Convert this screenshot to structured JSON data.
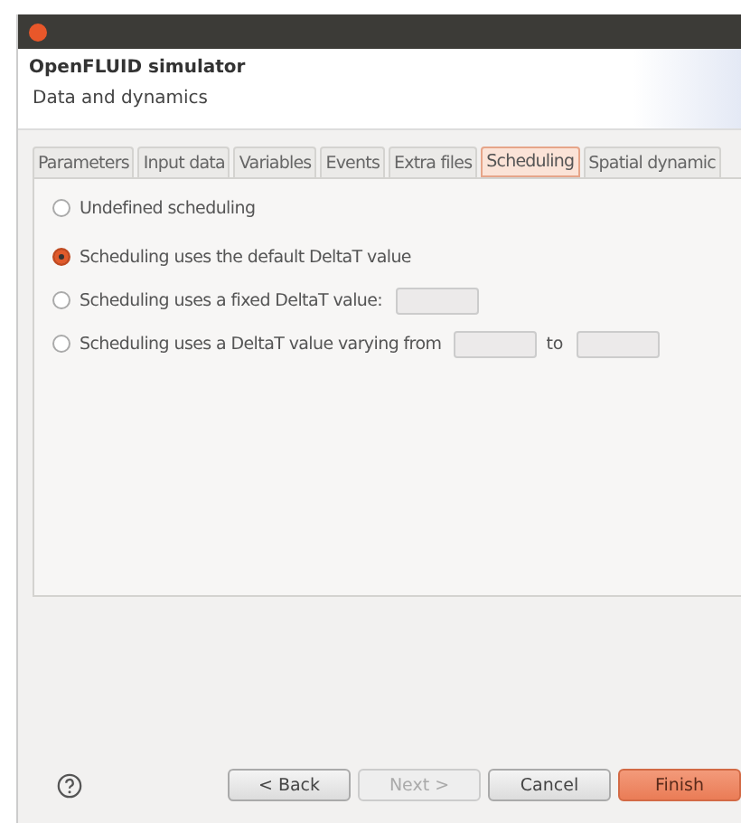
{
  "window": {
    "title": "OpenFLUID simulator",
    "subtitle": "Data and dynamics"
  },
  "tabs": [
    {
      "label": "Parameters",
      "selected": false
    },
    {
      "label": "Input data",
      "selected": false
    },
    {
      "label": "Variables",
      "selected": false
    },
    {
      "label": "Events",
      "selected": false
    },
    {
      "label": "Extra files",
      "selected": false
    },
    {
      "label": "Scheduling",
      "selected": true
    },
    {
      "label": "Spatial dynamic",
      "selected": false
    }
  ],
  "options": [
    {
      "label": "Undefined scheduling",
      "selected": false
    },
    {
      "label": "Scheduling uses the default DeltaT value",
      "selected": true
    },
    {
      "label": "Scheduling uses a fixed DeltaT value:",
      "selected": false,
      "fields": [
        {
          "kind": "input"
        }
      ]
    },
    {
      "label": "Scheduling uses a DeltaT value varying from",
      "selected": false,
      "fields": [
        {
          "kind": "input"
        },
        {
          "kind": "text",
          "label": "to"
        },
        {
          "kind": "input"
        }
      ]
    }
  ],
  "buttons": [
    {
      "label": "< Back",
      "disabled": false,
      "kind": "normal"
    },
    {
      "label": "Next >",
      "disabled": true,
      "kind": "normal"
    },
    {
      "label": "Cancel",
      "disabled": false,
      "kind": "normal"
    },
    {
      "label": "Finish",
      "disabled": false,
      "kind": "default"
    }
  ]
}
